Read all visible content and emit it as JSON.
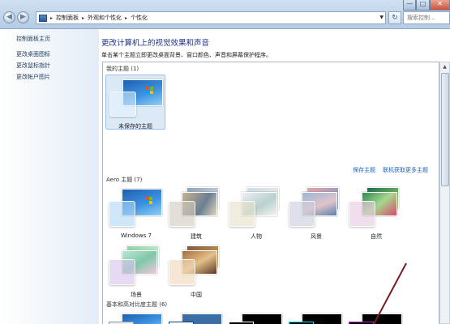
{
  "window": {
    "address": [
      "控制面板",
      "外观和个性化",
      "个性化"
    ],
    "search_placeholder": "搜索控制...",
    "buttons": {
      "minimize": "—",
      "maximize": "□",
      "close": "✕"
    },
    "refresh": "↻"
  },
  "sidebar": {
    "items": [
      {
        "label": "控制面板主页"
      },
      {
        "label": "更改桌面图标"
      },
      {
        "label": "更改鼠标指针"
      },
      {
        "label": "更改帐户图片"
      }
    ]
  },
  "main": {
    "title": "更改计算机上的视觉效果和声音",
    "subtitle": "单击某个主题立即更改桌面背景、窗口颜色、声音和屏幕保护程序。"
  },
  "themes": {
    "my_section": "我的主题 (1)",
    "my_items": [
      {
        "label": "未保存的主题"
      }
    ],
    "save_link": "保存主题",
    "online_link": "联机获取更多主题",
    "aero_section": "Aero 主题 (7)",
    "aero_items": [
      {
        "label": "Windows 7"
      },
      {
        "label": "建筑"
      },
      {
        "label": "人物"
      },
      {
        "label": "风景"
      },
      {
        "label": "自然"
      },
      {
        "label": "场景"
      },
      {
        "label": "中国"
      }
    ],
    "basic_section": "基本和高对比度主题 (6)"
  },
  "colors": {
    "win7_blue": "#2a7fd4",
    "link": "#1c5fb8",
    "title": "#1e3287"
  }
}
